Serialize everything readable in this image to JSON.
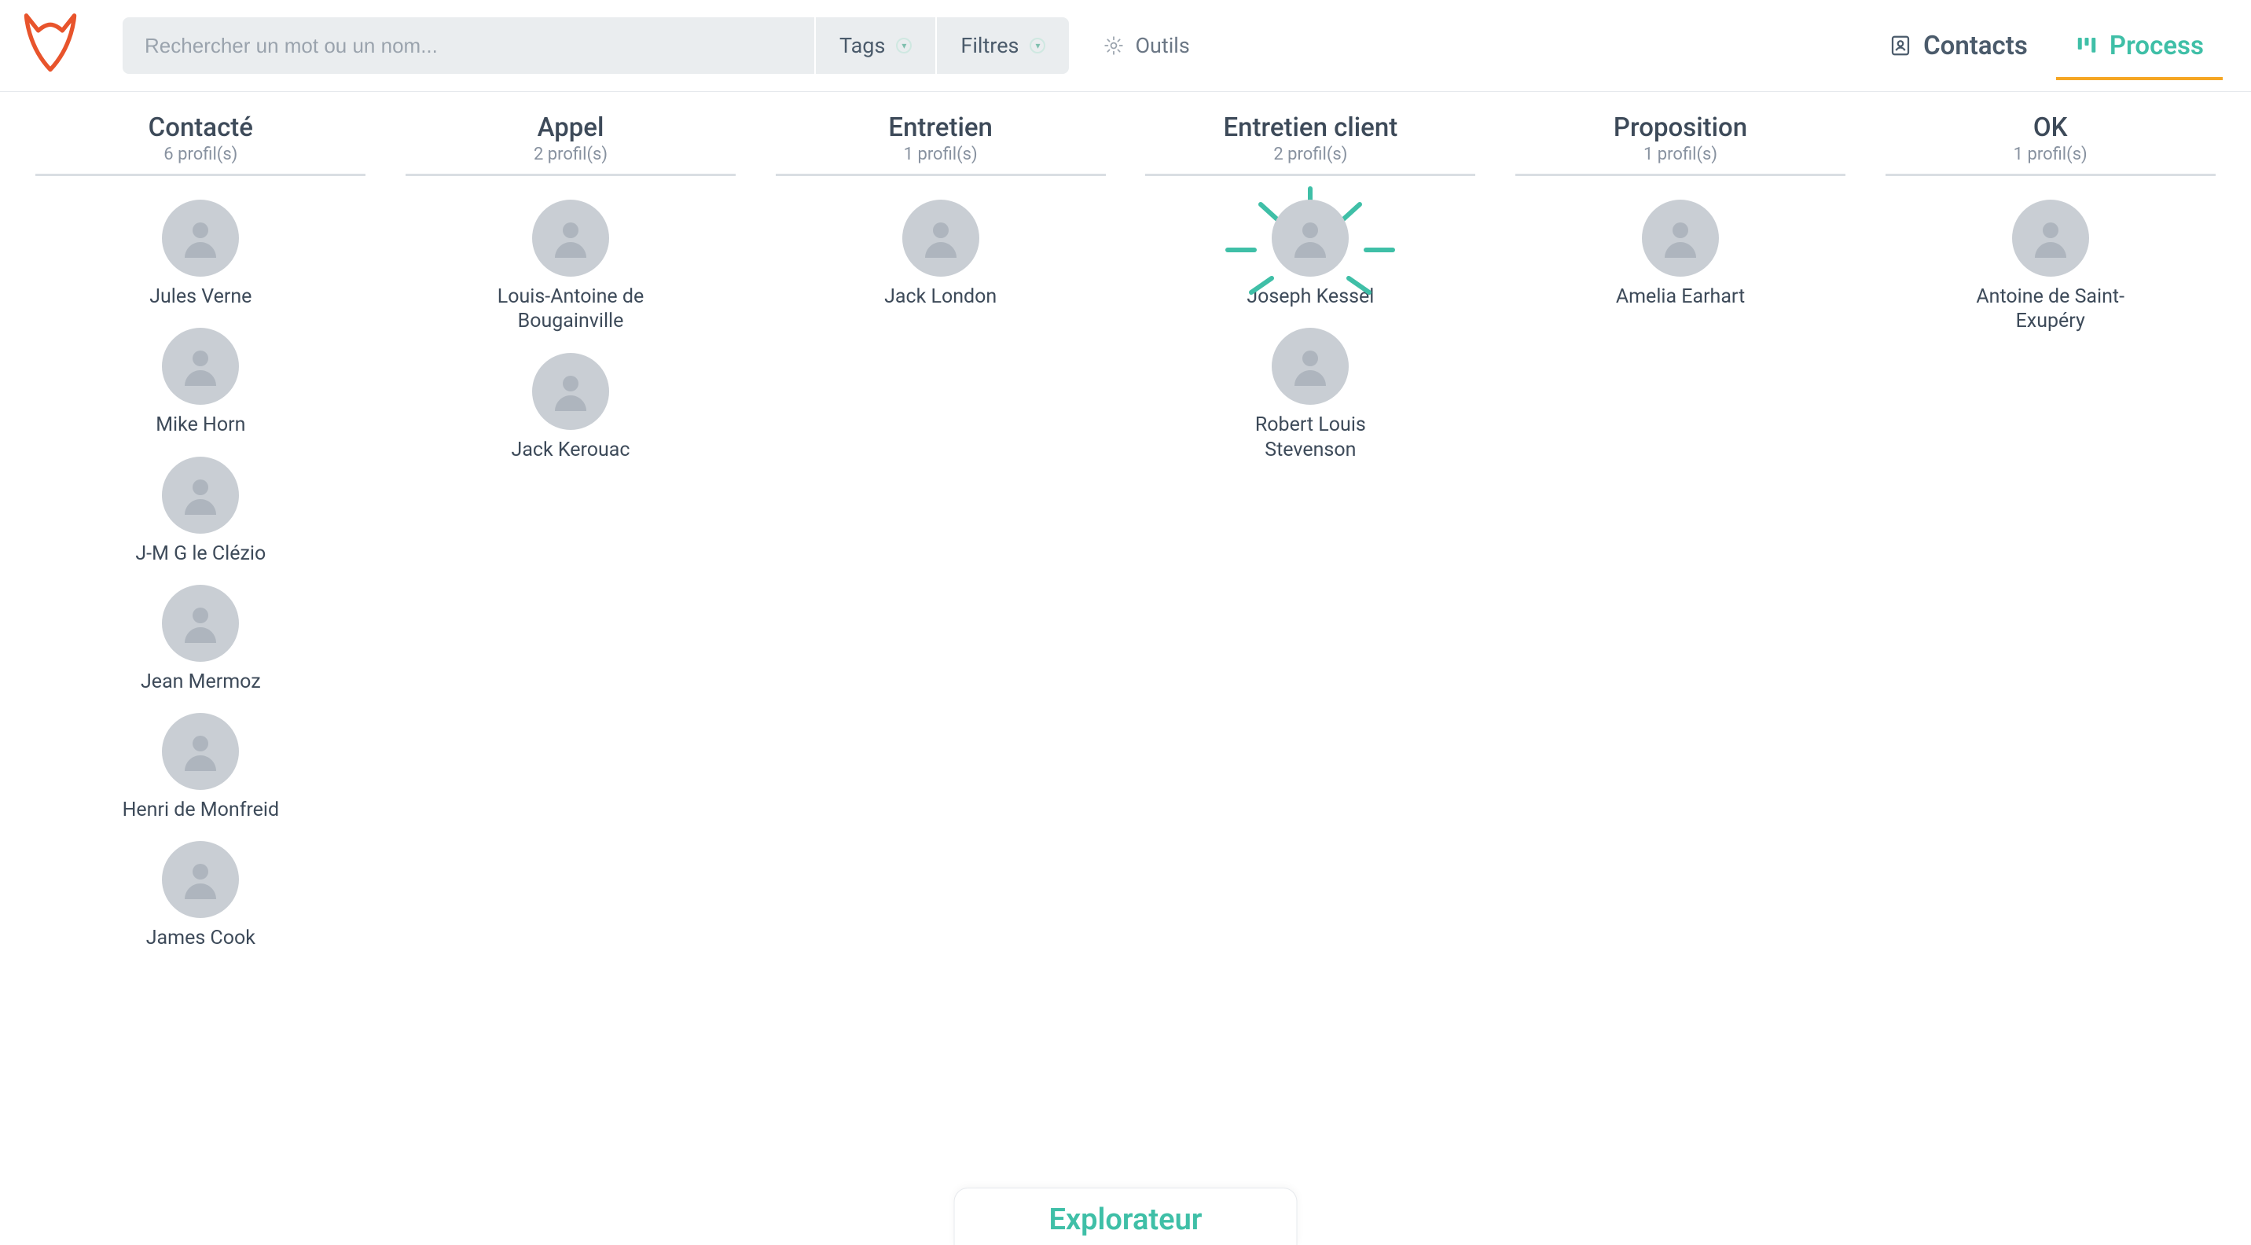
{
  "header": {
    "search_placeholder": "Rechercher un mot ou un nom...",
    "tags_label": "Tags",
    "filters_label": "Filtres",
    "tools_label": "Outils",
    "nav_contacts": "Contacts",
    "nav_process": "Process"
  },
  "columns": [
    {
      "title": "Contacté",
      "subtitle": "6 profil(s)",
      "items": [
        {
          "name": "Jules Verne"
        },
        {
          "name": "Mike Horn"
        },
        {
          "name": "J-M G le Clézio"
        },
        {
          "name": "Jean Mermoz"
        },
        {
          "name": "Henri de Monfreid"
        },
        {
          "name": "James Cook"
        }
      ]
    },
    {
      "title": "Appel",
      "subtitle": "2 profil(s)",
      "items": [
        {
          "name": "Louis-Antoine de Bougainville"
        },
        {
          "name": "Jack Kerouac"
        }
      ]
    },
    {
      "title": "Entretien",
      "subtitle": "1 profil(s)",
      "items": [
        {
          "name": "Jack London"
        }
      ]
    },
    {
      "title": "Entretien client",
      "subtitle": "2 profil(s)",
      "items": [
        {
          "name": "Joseph Kessel",
          "highlight": true
        },
        {
          "name": "Robert Louis Stevenson"
        }
      ]
    },
    {
      "title": "Proposition",
      "subtitle": "1 profil(s)",
      "items": [
        {
          "name": "Amelia Earhart"
        }
      ]
    },
    {
      "title": "OK",
      "subtitle": "1 profil(s)",
      "items": [
        {
          "name": "Antoine de Saint-Exupéry"
        }
      ]
    }
  ],
  "bottom_tab_label": "Explorateur",
  "colors": {
    "accent": "#3fbfa7",
    "logo": "#e8542c",
    "highlight_underline": "#f5a623"
  }
}
